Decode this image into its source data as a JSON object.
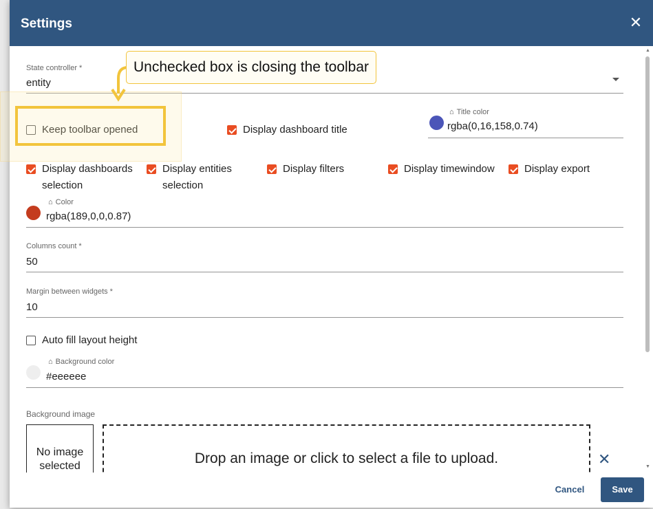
{
  "dialog": {
    "title": "Settings",
    "close_icon": "close-icon"
  },
  "state_controller": {
    "label": "State controller *",
    "value": "entity"
  },
  "checkboxes": {
    "keep_toolbar_opened": {
      "label": "Keep toolbar opened",
      "checked": false
    },
    "display_dashboard_title": {
      "label": "Display dashboard title",
      "checked": true
    },
    "display_dashboards_selection": {
      "label": "Display dashboards selection",
      "checked": true
    },
    "display_entities_selection": {
      "label": "Display entities selection",
      "checked": true
    },
    "display_filters": {
      "label": "Display filters",
      "checked": true
    },
    "display_timewindow": {
      "label": "Display timewindow",
      "checked": true
    },
    "display_export": {
      "label": "Display export",
      "checked": true
    },
    "auto_fill_layout_height": {
      "label": "Auto fill layout height",
      "checked": false
    }
  },
  "title_color": {
    "label": "Title color",
    "value": "rgba(0,16,158,0.74)",
    "swatch": "#4b55b8"
  },
  "color": {
    "label": "Color",
    "value": "rgba(189,0,0,0.87)",
    "swatch": "#c43c1e"
  },
  "columns_count": {
    "label": "Columns count *",
    "value": "50"
  },
  "margin_between_widgets": {
    "label": "Margin between widgets *",
    "value": "10"
  },
  "background_color": {
    "label": "Background color",
    "value": "#eeeeee",
    "swatch": "#eeeeee"
  },
  "background_image": {
    "label": "Background image",
    "preview_text": "No image selected",
    "dropzone_text": "Drop an image or click to select a file to upload."
  },
  "footer": {
    "cancel_label": "Cancel",
    "save_label": "Save"
  },
  "annotation": {
    "callout_text": "Unchecked box is closing the toolbar",
    "color": "#f2c43c"
  },
  "colors": {
    "header": "#305680",
    "accent": "#e94d22"
  }
}
